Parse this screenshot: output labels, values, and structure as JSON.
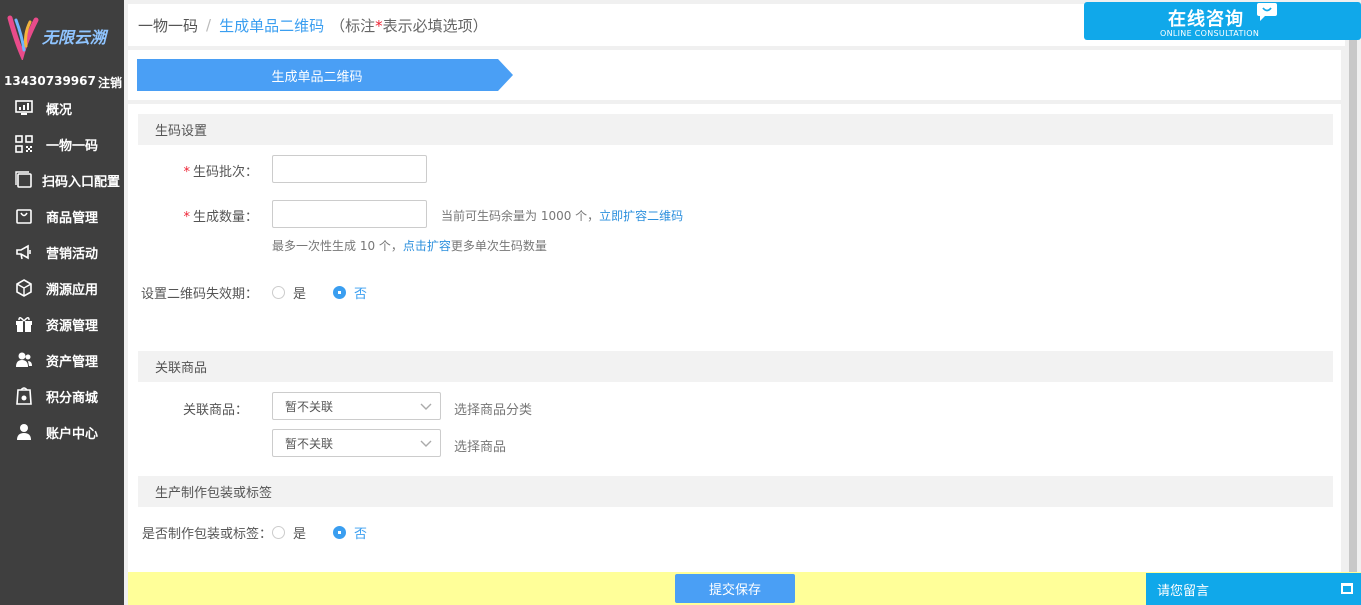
{
  "brand": {
    "logo_text": "无限云溯"
  },
  "user": {
    "phone": "13430739967",
    "logout": "注销"
  },
  "sidebar": {
    "items": [
      {
        "label": "概况",
        "icon": "monitor-icon"
      },
      {
        "label": "一物一码",
        "icon": "qrcode-icon"
      },
      {
        "label": "扫码入口配置",
        "icon": "window-icon"
      },
      {
        "label": "商品管理",
        "icon": "bag-icon"
      },
      {
        "label": "营销活动",
        "icon": "megaphone-icon"
      },
      {
        "label": "溯源应用",
        "icon": "box-icon"
      },
      {
        "label": "资源管理",
        "icon": "gift-icon"
      },
      {
        "label": "资产管理",
        "icon": "users-icon"
      },
      {
        "label": "积分商城",
        "icon": "shop-icon"
      },
      {
        "label": "账户中心",
        "icon": "person-icon"
      }
    ]
  },
  "breadcrumb": {
    "root": "一物一码",
    "sep": "/",
    "current": "生成单品二维码",
    "note_prefix": "（标注",
    "note_star": "*",
    "note_suffix": "表示必填选项）"
  },
  "online": {
    "title": "在线咨询",
    "subtitle": "ONLINE CONSULTATION"
  },
  "step": {
    "label": "生成单品二维码"
  },
  "section_code": {
    "title": "生码设置",
    "batch_label": "生码批次：",
    "batch_value": "",
    "qty_label": "生成数量：",
    "qty_value": "",
    "remaining_prefix": "当前可生码余量为 1000 个，",
    "remaining_link": "立即扩容二维码",
    "limit_prefix": "最多一次性生成 10 个，",
    "limit_link": "点击扩容",
    "limit_suffix": "更多单次生码数量",
    "expire_label": "设置二维码失效期：",
    "yes": "是",
    "no": "否",
    "selected": "no",
    "required_star": "*"
  },
  "section_goods": {
    "title": "关联商品",
    "label": "关联商品：",
    "category_value": "暂不关联",
    "category_hint": "选择商品分类",
    "goods_value": "暂不关联",
    "goods_hint": "选择商品"
  },
  "section_pack": {
    "title": "生产制作包装或标签",
    "label": "是否制作包装或标签：",
    "yes": "是",
    "no": "否",
    "selected": "no"
  },
  "footer": {
    "submit": "提交保存",
    "message": "请您留言"
  },
  "colors": {
    "accent": "#3a9ef0",
    "sidebar": "#3f3f3f",
    "footer_bg": "#ffff99",
    "online": "#10a8ea"
  }
}
